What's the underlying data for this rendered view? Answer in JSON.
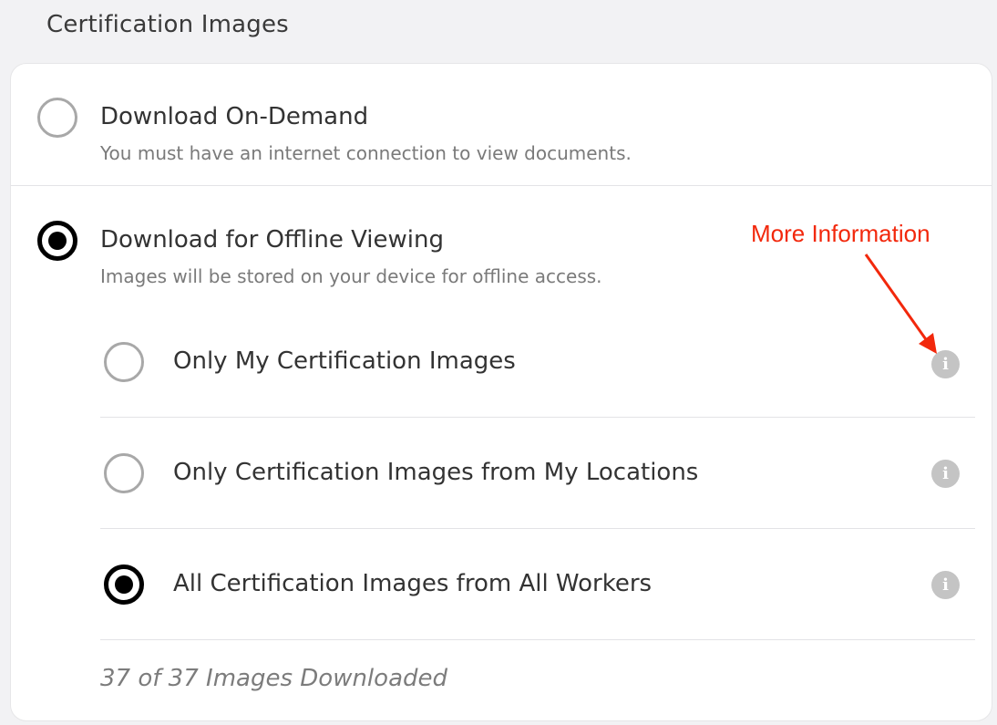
{
  "section": {
    "title": "Certification Images"
  },
  "options": [
    {
      "title": "Download On-Demand",
      "description": "You must have an internet connection to view documents.",
      "selected": false
    },
    {
      "title": "Download for Offline Viewing",
      "description": "Images will be stored on your device for offline access.",
      "selected": true
    }
  ],
  "sub_options": [
    {
      "label": "Only My Certification Images",
      "selected": false,
      "icon": "info-icon"
    },
    {
      "label": "Only Certification Images from My Locations",
      "selected": false,
      "icon": "info-icon"
    },
    {
      "label": "All Certification Images from All Workers",
      "selected": true,
      "icon": "info-icon"
    }
  ],
  "status": {
    "text": "37 of 37 Images Downloaded"
  },
  "annotation": {
    "text": "More Information",
    "color": "#f2280c"
  },
  "info_glyph": "i",
  "colors": {
    "selected_radio": "#000000",
    "unselected_radio": "#a8a8a8",
    "info_icon": "#c4c4c4"
  }
}
